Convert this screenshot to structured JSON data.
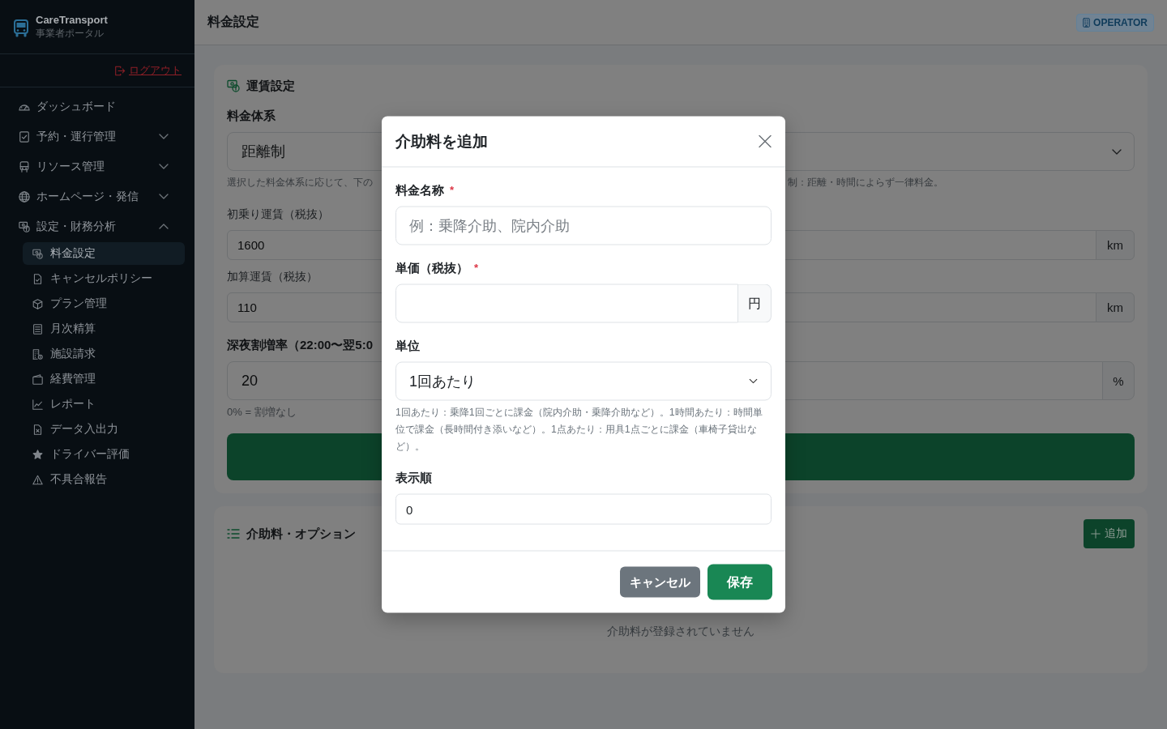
{
  "sidebar": {
    "brand": {
      "name": "CareTransport",
      "subtitle": "事業者ポータル"
    },
    "logout": "ログアウト",
    "items": [
      {
        "label": "ダッシュボード",
        "selected": false
      },
      {
        "label": "予約・運行管理",
        "selected": false,
        "expanded": false
      },
      {
        "label": "リソース管理",
        "selected": false,
        "expanded": false
      },
      {
        "label": "ホームページ・発信",
        "selected": false,
        "expanded": false
      },
      {
        "label": "設定・財務分析",
        "selected": false,
        "expanded": true,
        "children": [
          {
            "label": "料金設定",
            "selected": true
          },
          {
            "label": "キャンセルポリシー",
            "selected": false
          },
          {
            "label": "プラン管理",
            "selected": false
          },
          {
            "label": "月次精算",
            "selected": false
          },
          {
            "label": "施設請求",
            "selected": false
          },
          {
            "label": "経費管理",
            "selected": false
          },
          {
            "label": "レポート",
            "selected": false
          },
          {
            "label": "データ入出力",
            "selected": false
          },
          {
            "label": "ドライバー評価",
            "selected": false
          },
          {
            "label": "不具合報告",
            "selected": false
          }
        ]
      }
    ]
  },
  "header": {
    "title": "料金設定",
    "role_badge": "OPERATOR"
  },
  "fare_card": {
    "title": "運賃設定",
    "fare_system": {
      "label": "料金体系",
      "value": "距離制"
    },
    "help_left": "選択した料金体系に応じて、下の",
    "help_right": "制：距離・時間によらず一律料金。",
    "rows": [
      {
        "label": "初乗り運賃（税抜）",
        "value": "1600",
        "column_2_unit": "km"
      },
      {
        "label": "加算運賃（税抜）",
        "value": "110",
        "column_2_unit": "km"
      }
    ],
    "night_surcharge": {
      "label": "深夜割増率（22:00〜翌5:0",
      "value": "20",
      "unit": "%",
      "help": "0% = 割増なし"
    }
  },
  "options_card": {
    "title": "介助料・オプション",
    "add_button": "追加",
    "empty_text": "介助料が登録されていません"
  },
  "modal": {
    "title": "介助料を追加",
    "fields": [
      {
        "kind": "text",
        "label": "料金名称",
        "required_mark": "*",
        "placeholder": "例：乗降介助、院内介助"
      },
      {
        "kind": "price",
        "label": "単価（税抜）",
        "required_mark": "*",
        "addon": "円"
      },
      {
        "kind": "select",
        "label": "単位",
        "value": "1回あたり",
        "help": "1回あたり：乗降1回ごとに課金（院内介助・乗降介助など）。1時間あたり：時間単位で課金（長時間付き添いなど）。1点あたり：用具1点ごとに課金（車椅子貸出など）。"
      },
      {
        "kind": "number",
        "label": "表示順",
        "value": "0"
      }
    ],
    "buttons": [
      {
        "kind": "secondary",
        "label": "キャンセル"
      },
      {
        "kind": "primary",
        "label": "保存"
      }
    ]
  }
}
